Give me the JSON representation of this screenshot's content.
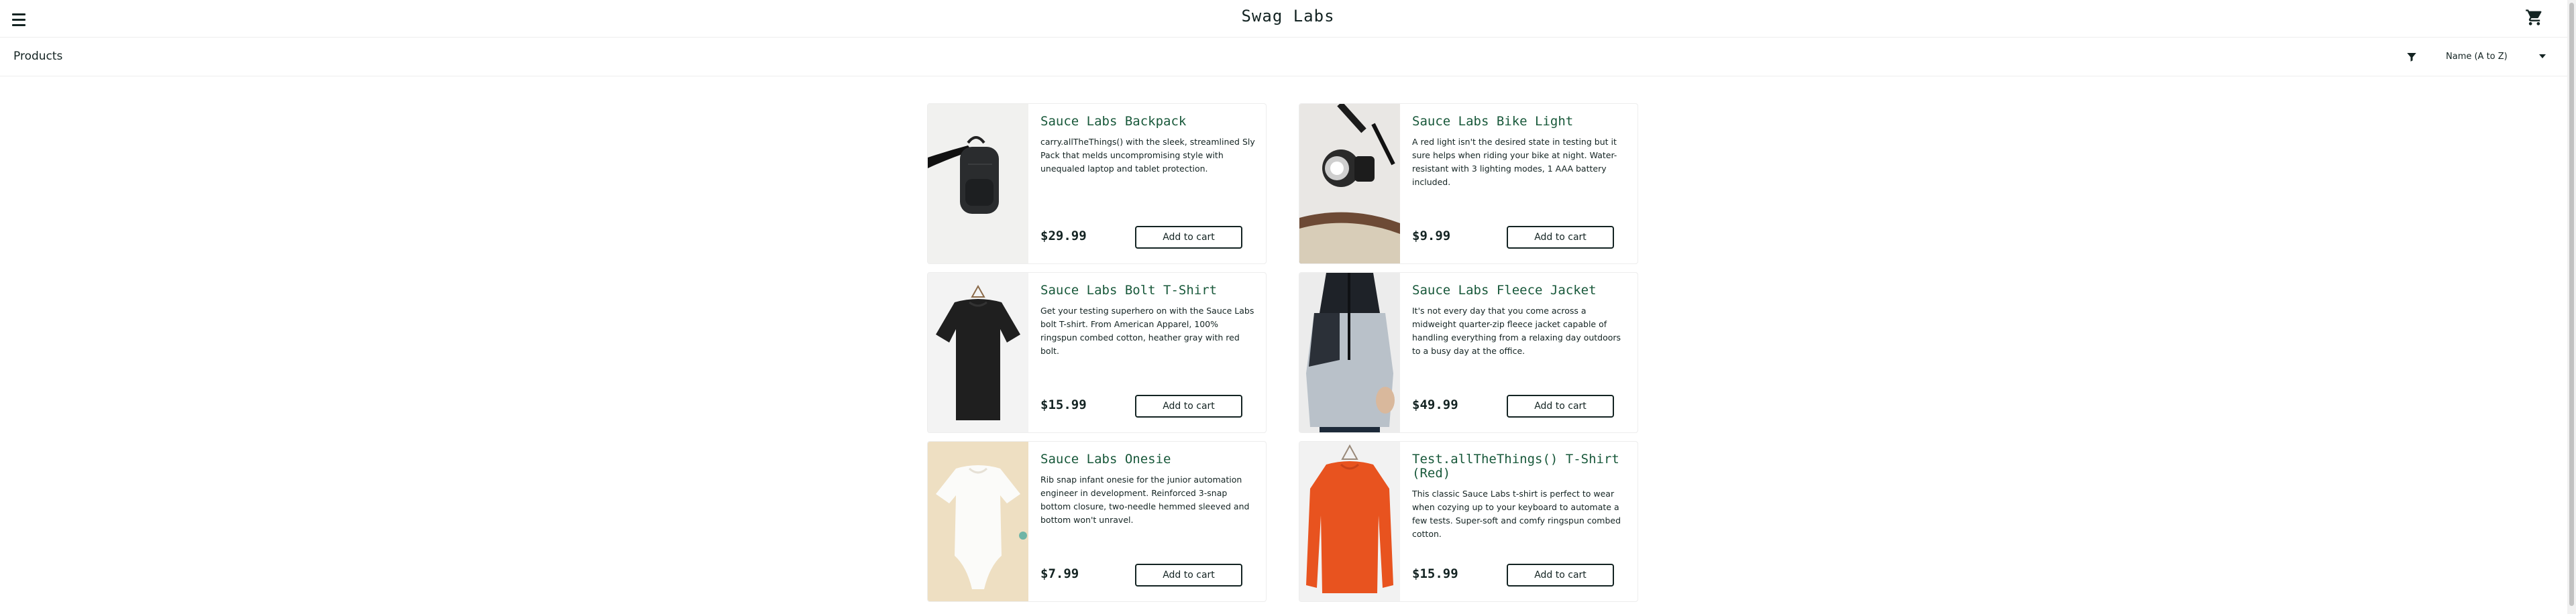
{
  "header": {
    "logo": "Swag Labs",
    "menu_icon": "hamburger-menu-icon",
    "cart_icon": "shopping-cart-icon"
  },
  "secondary": {
    "title": "Products",
    "filter_icon": "filter-icon",
    "sort_value": "Name (A to Z)",
    "sort_caret_icon": "caret-down-icon"
  },
  "inventory": {
    "items": [
      {
        "name": "Sauce Labs Backpack",
        "description": "carry.allTheThings() with the sleek, streamlined Sly Pack that melds uncompromising style with unequaled laptop and tablet protection.",
        "price": "$29.99",
        "button": "Add to cart"
      },
      {
        "name": "Sauce Labs Bike Light",
        "description": "A red light isn't the desired state in testing but it sure helps when riding your bike at night. Water-resistant with 3 lighting modes, 1 AAA battery included.",
        "price": "$9.99",
        "button": "Add to cart"
      },
      {
        "name": "Sauce Labs Bolt T-Shirt",
        "description": "Get your testing superhero on with the Sauce Labs bolt T-shirt. From American Apparel, 100% ringspun combed cotton, heather gray with red bolt.",
        "price": "$15.99",
        "button": "Add to cart"
      },
      {
        "name": "Sauce Labs Fleece Jacket",
        "description": "It's not every day that you come across a midweight quarter-zip fleece jacket capable of handling everything from a relaxing day outdoors to a busy day at the office.",
        "price": "$49.99",
        "button": "Add to cart"
      },
      {
        "name": "Sauce Labs Onesie",
        "description": "Rib snap infant onesie for the junior automation engineer in development. Reinforced 3-snap bottom closure, two-needle hemmed sleeved and bottom won't unravel.",
        "price": "$7.99",
        "button": "Add to cart"
      },
      {
        "name": "Test.allTheThings() T-Shirt (Red)",
        "description": "This classic Sauce Labs t-shirt is perfect to wear when cozying up to your keyboard to automate a few tests. Super-soft and comfy ringspun combed cotton.",
        "price": "$15.99",
        "button": "Add to cart"
      }
    ]
  }
}
